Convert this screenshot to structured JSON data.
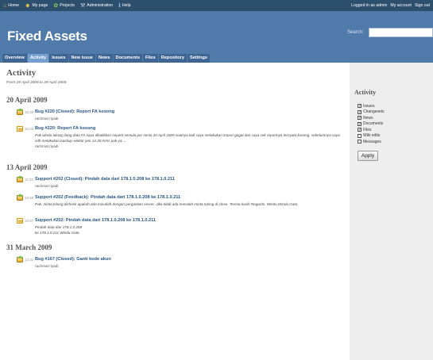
{
  "top_menu": {
    "items": [
      {
        "label": "Home",
        "icon": "home-icon"
      },
      {
        "label": "My page",
        "icon": "user-icon"
      },
      {
        "label": "Projects",
        "icon": "projects-icon"
      },
      {
        "label": "Administration",
        "icon": "tools-icon"
      },
      {
        "label": "Help",
        "icon": "help-icon"
      }
    ],
    "logged_in": "Logged in as admin",
    "my_account": "My account",
    "sign_out": "Sign out"
  },
  "header": {
    "title": "Fixed Assets",
    "search_label": "Search:",
    "search_value": ""
  },
  "main_menu": {
    "tabs": [
      "Overview",
      "Activity",
      "Issues",
      "New issue",
      "News",
      "Documents",
      "Files",
      "Repository",
      "Settings"
    ],
    "selected": "Activity"
  },
  "content": {
    "title": "Activity",
    "subtitle": "From 29 April 2008 to 28 April 2009",
    "days": [
      {
        "date": "20 April 2009",
        "events": [
          {
            "time": "16:39",
            "icon": "issue-icon",
            "title": "Bug #220 (Closed): Report FA kosong",
            "description": "",
            "author": "rachmat riyadi"
          },
          {
            "time": "15:08",
            "icon": "news-icon",
            "title": "Bug #220: Report FA kosong",
            "description": "Pak windu tolong dong data FA saya dibalikkan seperti semula per senin,20 April 2009 soalnya tadi saya melakukan import gagal dan saya cek reportnya ternyata kosong, sebelumnya saya sdh melakukan backup sekitar jam 14.30 trims pak ya......",
            "author": "rachmat riyadi"
          }
        ]
      },
      {
        "date": "13 April 2009",
        "events": [
          {
            "time": "11:33",
            "icon": "issue-icon",
            "title": "Support #202 (Closed): Pindah data dari 178.1.0.208 ke 178.1.0.211",
            "description": "",
            "author": "rachmat riyadi"
          },
          {
            "time": "10:58",
            "icon": "issue-icon",
            "title": "Support #202 (Feedback): Pindah data dari 178.1.0.208 ke 178.1.0.211",
            "description": "Pak, minta tolong dicheck apakah ada masalah dengan pergantian server. Jika tidak ada masalah minta tolong di close. Terima kasih Regards, Windu Windu Gata",
            "author": ""
          },
          {
            "time": "10:57",
            "icon": "news-icon",
            "title": "Support #202: Pindah data dari 178.1.0.208 ke 178.1.0.211",
            "description": "Pindah data dari 178.1.0.208 ke 178.1.0.211 Windu Gata",
            "author": ""
          }
        ]
      },
      {
        "date": "31 March 2009",
        "events": [
          {
            "time": "14:32",
            "icon": "issue-icon",
            "title": "Bug #167 (Closed): Ganti kode akun",
            "description": "",
            "author": "rachmat riyadi"
          }
        ]
      }
    ]
  },
  "sidebar": {
    "title": "Activity",
    "filters": [
      {
        "label": "Issues",
        "checked": true
      },
      {
        "label": "Changesets",
        "checked": true
      },
      {
        "label": "News",
        "checked": true
      },
      {
        "label": "Documents",
        "checked": true
      },
      {
        "label": "Files",
        "checked": true
      },
      {
        "label": "Wiki edits",
        "checked": false
      },
      {
        "label": "Messages",
        "checked": false
      }
    ],
    "apply_label": "Apply"
  },
  "colors": {
    "top_bar": "#2c4f6e",
    "header": "#507aaa",
    "selected_tab": "#759fcf",
    "link": "#2a5685",
    "sidebar": "#eeeeee"
  }
}
